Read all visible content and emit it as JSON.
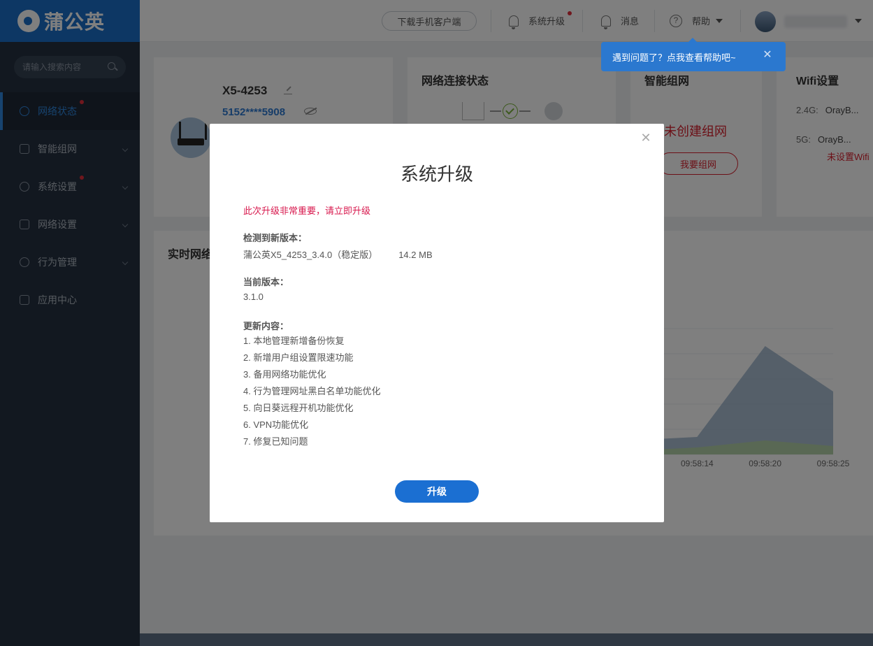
{
  "brand": {
    "name": "蒲公英"
  },
  "sidebar": {
    "search_placeholder": "请输入搜索内容",
    "items": [
      {
        "label": "网络状态",
        "active": true,
        "badge": true
      },
      {
        "label": "智能组网",
        "chevron": true
      },
      {
        "label": "系统设置",
        "badge": true,
        "chevron": true
      },
      {
        "label": "网络设置",
        "chevron": true
      },
      {
        "label": "行为管理",
        "chevron": true
      },
      {
        "label": "应用中心"
      }
    ]
  },
  "header": {
    "download_label": "下载手机客户端",
    "upgrade_label": "系统升级",
    "messages_label": "消息",
    "help_label": "帮助"
  },
  "tooltip": {
    "text": "遇到问题了？点我查看帮助吧~"
  },
  "device_card": {
    "name": "X5-4253",
    "sn": "5152****5908"
  },
  "network_card": {
    "title": "网络连接状态"
  },
  "mesh_card": {
    "title": "智能组网",
    "status": "未创建组网",
    "button": "我要组网"
  },
  "wifi_card": {
    "title": "Wifi设置",
    "rows": [
      {
        "band": "2.4G:",
        "ssid": "OrayB..."
      },
      {
        "band": "5G:",
        "ssid": "OrayB..."
      }
    ],
    "warning": "未设置Wifi"
  },
  "chart_card": {
    "title": "实时网络"
  },
  "chart_data": {
    "type": "area",
    "title": "实时网络",
    "x": [
      "",
      "09:58:14",
      "09:58:20",
      "09:58:25"
    ],
    "series": [
      {
        "values": [
          20,
          25,
          155,
          90
        ],
        "color": "#8ea8c4"
      },
      {
        "values": [
          5,
          10,
          20,
          12
        ],
        "color": "#b5d3a1"
      }
    ],
    "ylim": [
      0,
      180
    ],
    "grid": true
  },
  "modal": {
    "title": "系统升级",
    "warning": "此次升级非常重要，请立即升级",
    "new_version_label": "检测到新版本：",
    "new_version_value": "蒲公英X5_4253_3.4.0（稳定版）",
    "new_version_size": "14.2 MB",
    "current_version_label": "当前版本：",
    "current_version_value": "3.1.0",
    "changes_label": "更新内容：",
    "changes": [
      "1. 本地管理新增备份恢复",
      "2. 新增用户组设置限速功能",
      "3. 备用网络功能优化",
      "4. 行为管理网址黑白名单功能优化",
      "5. 向日葵远程开机功能优化",
      "6. VPN功能优化",
      "7. 修复已知问题"
    ],
    "upgrade_button": "升级"
  },
  "colors": {
    "primary": "#1b6fc9",
    "danger": "#d8212e",
    "sidebar_bg": "#253140"
  }
}
